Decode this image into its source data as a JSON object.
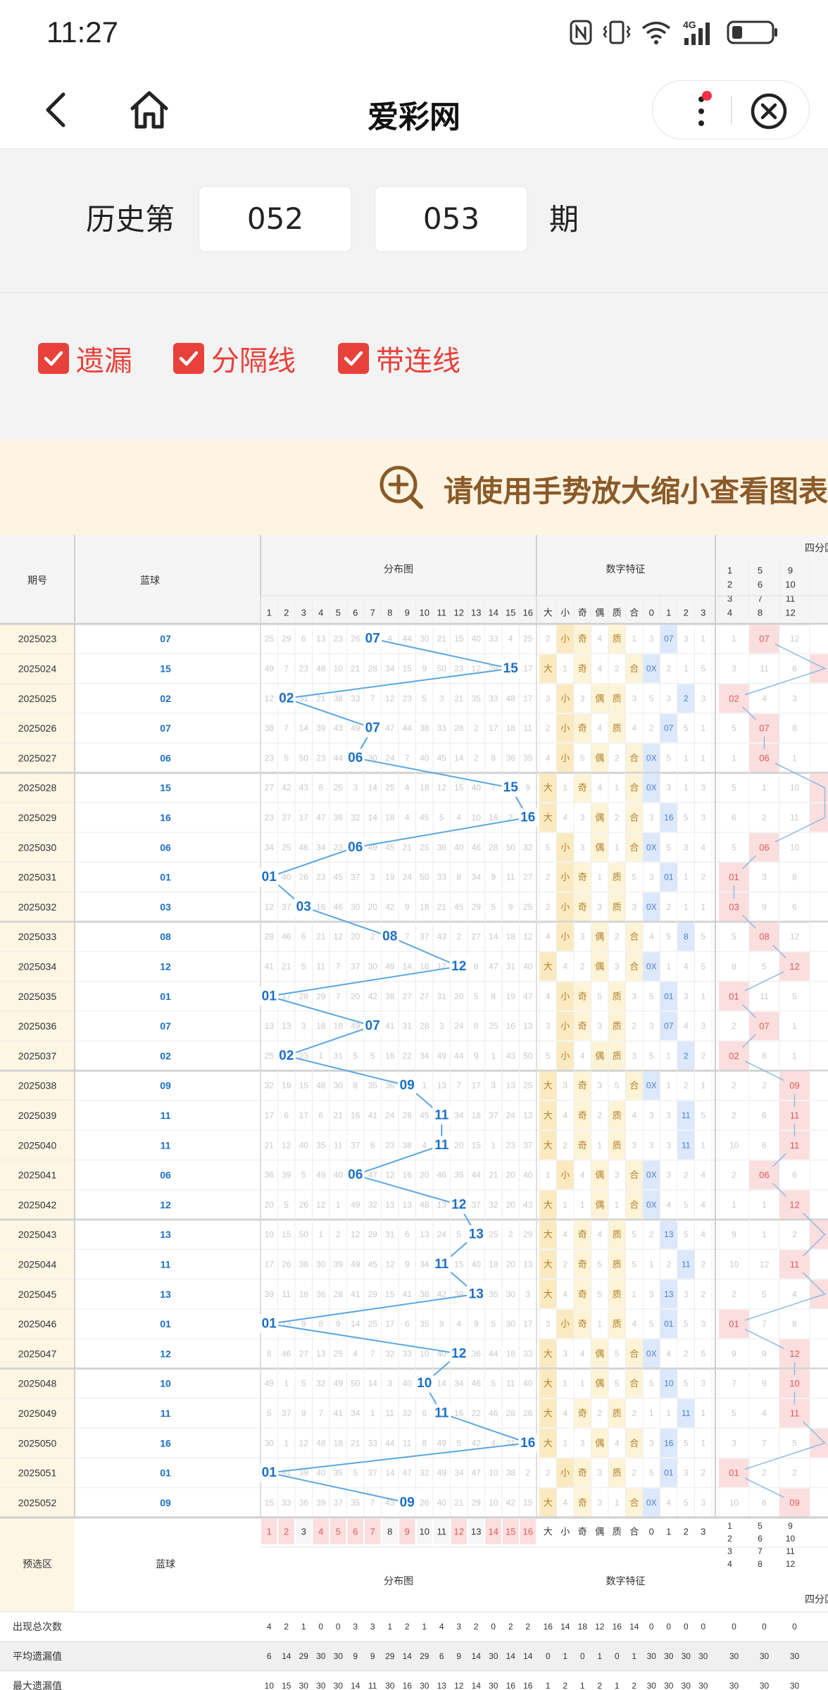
{
  "status_bar": {
    "time": "11:27",
    "network": "4G"
  },
  "nav": {
    "title": "爱彩网",
    "back_icon": "chevron-left-icon",
    "home_icon": "home-icon",
    "more_icon": "more-vertical-icon",
    "close_icon": "close-circle-icon"
  },
  "period": {
    "prefix": "历史第",
    "from": "052",
    "to": "053",
    "suffix": "期"
  },
  "options": [
    {
      "label": "遗漏",
      "checked": true
    },
    {
      "label": "分隔线",
      "checked": true
    },
    {
      "label": "带连线",
      "checked": true
    }
  ],
  "hint": {
    "text": "请使用手势放大缩小查看图表"
  },
  "table": {
    "headers": {
      "issue": "期号",
      "blue": "蓝球",
      "dist": "分布图",
      "feat": "数字特征",
      "quad": "四分区法"
    },
    "dist_cols": [
      "1",
      "2",
      "3",
      "4",
      "5",
      "6",
      "7",
      "8",
      "9",
      "10",
      "11",
      "12",
      "13",
      "14",
      "15",
      "16"
    ],
    "feat_cols": [
      "大",
      "小",
      "奇",
      "偶",
      "质",
      "合",
      "0",
      "1",
      "2",
      "3"
    ],
    "quad_cols": [
      "1\n2\n3\n4",
      "5\n6\n7\n8",
      "9\n10\n11\n12"
    ],
    "rows": [
      {
        "issue": "2025023",
        "blue": "07"
      },
      {
        "issue": "2025024",
        "blue": "15"
      },
      {
        "issue": "2025025",
        "blue": "02"
      },
      {
        "issue": "2025026",
        "blue": "07"
      },
      {
        "issue": "2025027",
        "blue": "06"
      },
      {
        "issue": "2025028",
        "blue": "15"
      },
      {
        "issue": "2025029",
        "blue": "16"
      },
      {
        "issue": "2025030",
        "blue": "06"
      },
      {
        "issue": "2025031",
        "blue": "01"
      },
      {
        "issue": "2025032",
        "blue": "03"
      },
      {
        "issue": "2025033",
        "blue": "08"
      },
      {
        "issue": "2025034",
        "blue": "12"
      },
      {
        "issue": "2025035",
        "blue": "01"
      },
      {
        "issue": "2025036",
        "blue": "07"
      },
      {
        "issue": "2025037",
        "blue": "02"
      },
      {
        "issue": "2025038",
        "blue": "09"
      },
      {
        "issue": "2025039",
        "blue": "11"
      },
      {
        "issue": "2025040",
        "blue": "11"
      },
      {
        "issue": "2025041",
        "blue": "06"
      },
      {
        "issue": "2025042",
        "blue": "12"
      },
      {
        "issue": "2025043",
        "blue": "13"
      },
      {
        "issue": "2025044",
        "blue": "11"
      },
      {
        "issue": "2025045",
        "blue": "13"
      },
      {
        "issue": "2025046",
        "blue": "01"
      },
      {
        "issue": "2025047",
        "blue": "12"
      },
      {
        "issue": "2025048",
        "blue": "10"
      },
      {
        "issue": "2025049",
        "blue": "11"
      },
      {
        "issue": "2025050",
        "blue": "16"
      },
      {
        "issue": "2025051",
        "blue": "01"
      },
      {
        "issue": "2025052",
        "blue": "09"
      }
    ],
    "preselect_label": "预选区",
    "stats": [
      {
        "label": "出现总次数",
        "values": [
          "4",
          "2",
          "1",
          "0",
          "0",
          "3",
          "3",
          "1",
          "2",
          "1",
          "4",
          "3",
          "2",
          "0",
          "2",
          "2"
        ],
        "feat": [
          "16",
          "14",
          "18",
          "12",
          "16",
          "14",
          "0",
          "0",
          "0",
          "0"
        ],
        "quad": [
          "0",
          "0",
          "0"
        ]
      },
      {
        "label": "平均遗漏值",
        "values": [
          "6",
          "14",
          "29",
          "30",
          "30",
          "9",
          "9",
          "29",
          "14",
          "29",
          "6",
          "9",
          "14",
          "30",
          "14",
          "14"
        ],
        "feat": [
          "0",
          "1",
          "0",
          "1",
          "0",
          "1",
          "30",
          "30",
          "30",
          "30"
        ],
        "quad": [
          "30",
          "30",
          "30"
        ]
      },
      {
        "label": "最大遗漏值",
        "values": [
          "10",
          "15",
          "30",
          "30",
          "30",
          "14",
          "11",
          "30",
          "16",
          "30",
          "13",
          "12",
          "14",
          "30",
          "16",
          "16"
        ],
        "feat": [
          "1",
          "2",
          "1",
          "2",
          "1",
          "2",
          "30",
          "30",
          "30",
          "30"
        ],
        "quad": [
          "30",
          "30",
          "30"
        ]
      }
    ]
  },
  "colors": {
    "accent": "#e8413b",
    "blue_ball": "#1b6fc4",
    "line": "#5ba7e0",
    "hint_bg": "#fdf4e3",
    "hint_text": "#8a5a28",
    "feat_big": "#fbeac0",
    "feat_small": "#fdf3d6",
    "feat_zero": "#dce8fb",
    "quad_hl": "#fbdede"
  }
}
